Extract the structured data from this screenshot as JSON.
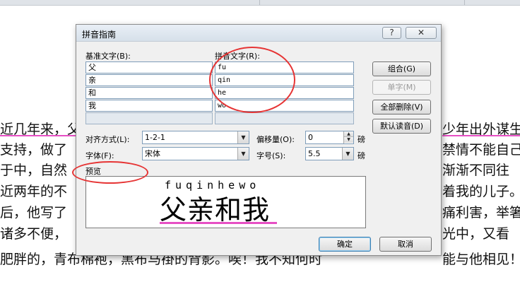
{
  "document": {
    "lines_left": [
      "近几年来，父",
      "支持，做了",
      "于中，自然",
      "近两年的不",
      "后，他写了",
      "诸多不便，",
      "肥胖的，青布棉袍，黑布马褂的背影。唉！我不知何时"
    ],
    "lines_right": [
      "少年出外谋生",
      "禁情不能自己",
      "渐渐不同往",
      "着我的儿子。",
      "痛利害，举箸",
      "光中，又看",
      "能与他相见！"
    ]
  },
  "dialog": {
    "title": "拼音指南",
    "help_icon": "?",
    "close_icon": "✕",
    "base_text_label": "基准文字(B):",
    "ruby_text_label": "拼音文字(R):",
    "base_text": [
      "父",
      "亲",
      "和",
      "我",
      ""
    ],
    "ruby_text": [
      "fu",
      "qin",
      "he",
      "wo",
      ""
    ],
    "buttons": {
      "group": "组合(G)",
      "single": "单字(M)",
      "clear_all": "全部删除(V)",
      "default_reading": "默认读音(D)",
      "ok": "确定",
      "cancel": "取消"
    },
    "alignment_label": "对齐方式(L):",
    "alignment_value": "1-2-1",
    "offset_label": "偏移量(O):",
    "offset_value": "0",
    "offset_unit": "磅",
    "font_label": "字体(F):",
    "font_value": "宋体",
    "size_label": "字号(S):",
    "size_value": "5.5",
    "size_unit": "磅",
    "preview_label": "预览",
    "preview_ruby": "fuqinhewo",
    "preview_text": "父亲和我",
    "dropdown_icon": "▼",
    "spin_up_icon": "▲",
    "spin_down_icon": "▼"
  },
  "colors": {
    "annotation": "#e63434",
    "underline": "#e64fc4",
    "dialog_bg": "#f0f0f0"
  }
}
